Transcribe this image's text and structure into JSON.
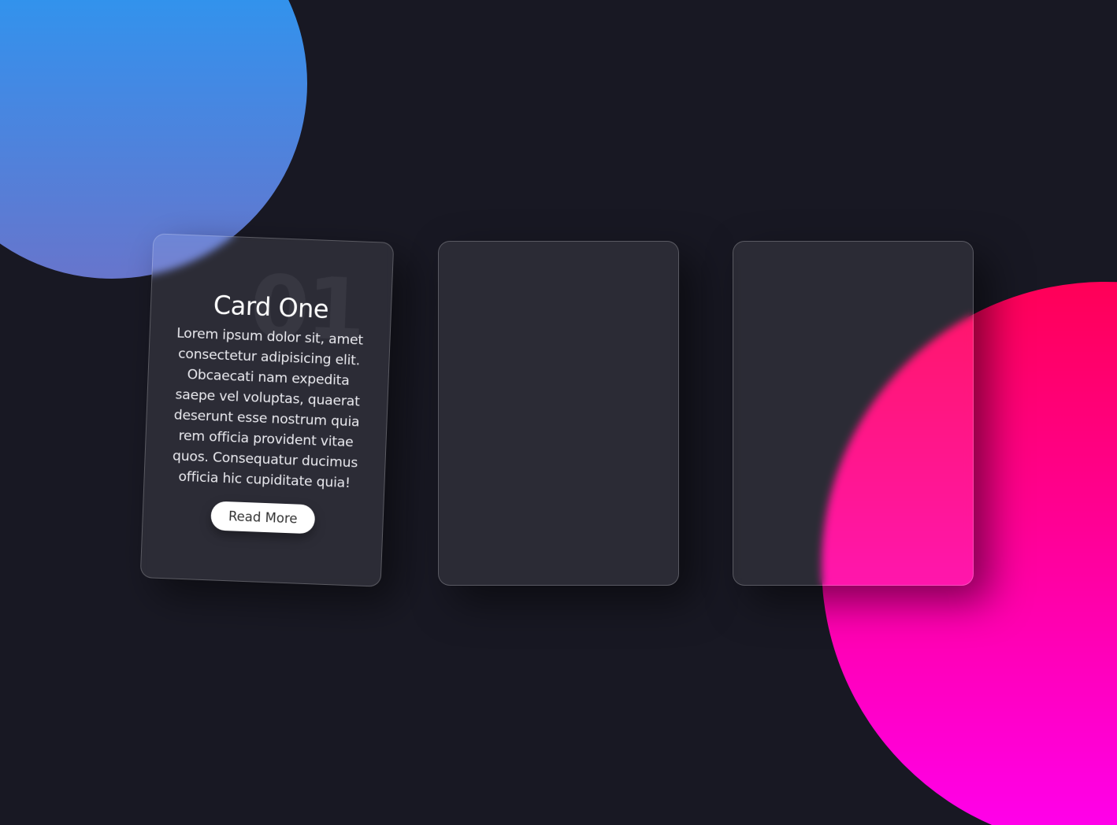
{
  "cards": [
    {
      "number": "01",
      "title": "Card One",
      "text": "Lorem ipsum dolor sit, amet consectetur adipisicing elit. Obcaecati nam expedita saepe vel voluptas, quaerat deserunt esse nostrum quia rem officia provident vitae quos. Consequatur ducimus officia hic cupiditate quia!",
      "button_label": "Read More"
    }
  ],
  "colors": {
    "background": "#181823",
    "blob_blue_top": "#1ca0f7",
    "blob_blue_bottom": "#6775cc",
    "blob_pink_top": "#ff0057",
    "blob_pink_bottom": "#ff00f0",
    "button_bg": "#ffffff"
  }
}
